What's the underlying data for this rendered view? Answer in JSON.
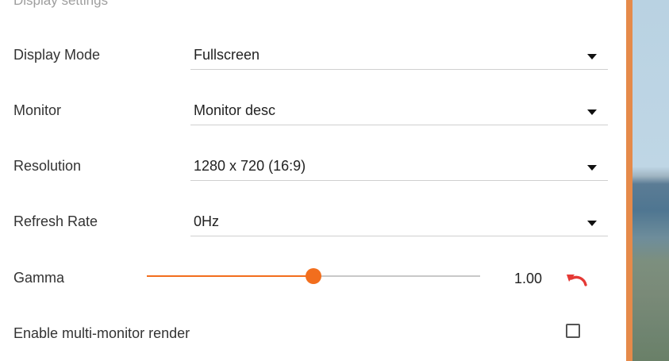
{
  "section": {
    "title": "Display settings"
  },
  "rows": {
    "display_mode": {
      "label": "Display Mode",
      "value": "Fullscreen"
    },
    "monitor": {
      "label": "Monitor",
      "value": "Monitor desc"
    },
    "resolution": {
      "label": "Resolution",
      "value": "1280 x 720 (16:9)"
    },
    "refresh_rate": {
      "label": "Refresh Rate",
      "value": "0Hz"
    },
    "gamma": {
      "label": "Gamma",
      "value": "1.00",
      "slider_fraction": 0.5
    },
    "multi_monitor": {
      "label": "Enable multi-monitor render",
      "checked": false
    }
  },
  "icons": {
    "dropdown": "dropdown-arrow-icon",
    "reset": "undo-icon",
    "checkbox": "checkbox-icon"
  },
  "colors": {
    "accent": "#f26e1d",
    "reset_icon": "#e53935",
    "side_bar": "#e58a4a",
    "label_text": "#333333",
    "muted_text": "#9e9e9e"
  }
}
